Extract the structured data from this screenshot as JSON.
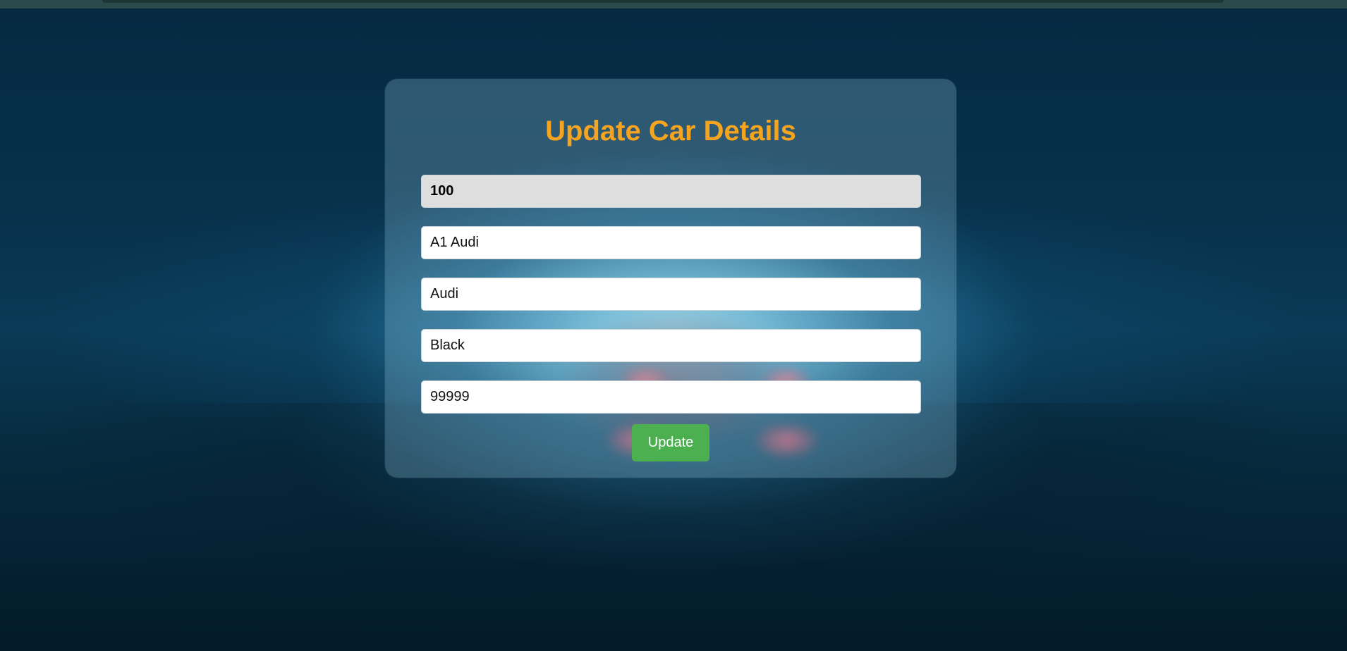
{
  "form": {
    "title": "Update Car Details",
    "fields": [
      {
        "name": "car-id",
        "value": "100",
        "readonly": true
      },
      {
        "name": "model",
        "value": "A1 Audi"
      },
      {
        "name": "brand",
        "value": "Audi"
      },
      {
        "name": "color",
        "value": "Black"
      },
      {
        "name": "price",
        "value": "99999"
      }
    ],
    "submit_label": "Update"
  },
  "colors": {
    "title": "#f5a41f",
    "button": "#4caf50",
    "readonly_field": "#dedede"
  }
}
